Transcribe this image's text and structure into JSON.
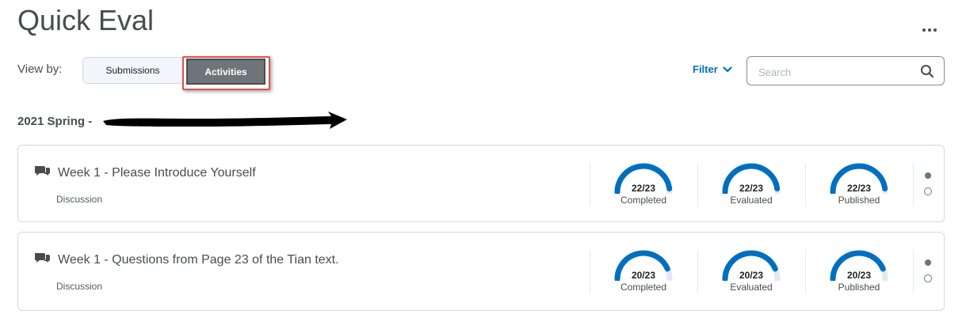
{
  "page": {
    "title": "Quick Eval"
  },
  "view_by": {
    "label": "View by:",
    "submissions": "Submissions",
    "activities": "Activities",
    "selected": "Activities"
  },
  "filter": {
    "label": "Filter"
  },
  "search": {
    "placeholder": "Search"
  },
  "semester": {
    "label": "2021 Spring -"
  },
  "colors": {
    "accent": "#006fbf",
    "gauge_track": "#e3e9f1",
    "highlight": "#e2504a"
  },
  "activities": [
    {
      "title": "Week 1 - Please Introduce Yourself",
      "type": "Discussion",
      "icon": "discussion-icon",
      "stats": [
        {
          "count": "22/23",
          "label": "Completed",
          "done": 22,
          "total": 23
        },
        {
          "count": "22/23",
          "label": "Evaluated",
          "done": 22,
          "total": 23
        },
        {
          "count": "22/23",
          "label": "Published",
          "done": 22,
          "total": 23
        }
      ]
    },
    {
      "title": "Week 1 - Questions from Page 23 of the Tian text.",
      "type": "Discussion",
      "icon": "discussion-icon",
      "stats": [
        {
          "count": "20/23",
          "label": "Completed",
          "done": 20,
          "total": 23
        },
        {
          "count": "20/23",
          "label": "Evaluated",
          "done": 20,
          "total": 23
        },
        {
          "count": "20/23",
          "label": "Published",
          "done": 20,
          "total": 23
        }
      ]
    }
  ]
}
